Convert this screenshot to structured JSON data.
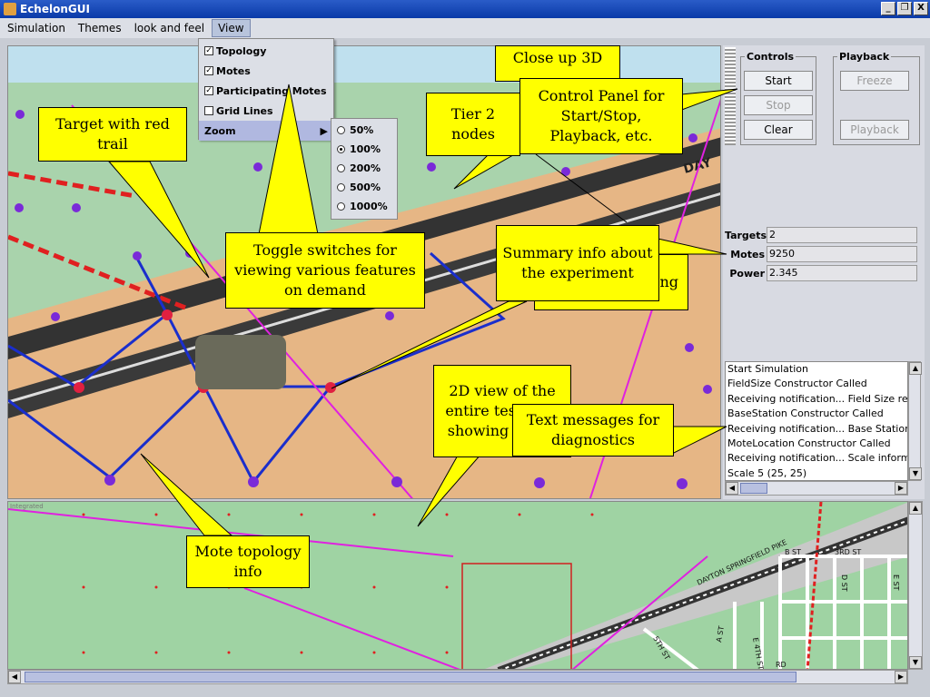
{
  "window": {
    "title": "EchelonGUI",
    "minimize": "_",
    "restore": "❐",
    "close": "X"
  },
  "menubar": [
    "Simulation",
    "Themes",
    "look and feel",
    "View"
  ],
  "view_menu": {
    "items": [
      {
        "label": "Topology",
        "checked": true
      },
      {
        "label": "Motes",
        "checked": true
      },
      {
        "label": "Participating Motes",
        "checked": true
      },
      {
        "label": "Grid Lines",
        "checked": false
      }
    ],
    "zoom_label": "Zoom",
    "zoom_options": [
      {
        "label": "50%",
        "selected": false
      },
      {
        "label": "100%",
        "selected": true
      },
      {
        "label": "200%",
        "selected": false
      },
      {
        "label": "500%",
        "selected": false
      },
      {
        "label": "1000%",
        "selected": false
      }
    ]
  },
  "controls": {
    "legend": "Controls",
    "start": "Start",
    "stop": "Stop",
    "clear": "Clear"
  },
  "playback": {
    "legend": "Playback",
    "freeze": "Freeze",
    "playback": "Playback"
  },
  "summary": {
    "targets_label": "Targets",
    "targets_value": "2",
    "motes_label": "Motes",
    "motes_value": "9250",
    "power_label": "Power",
    "power_value": "2.345"
  },
  "log": [
    "Start Simulation",
    "FieldSize Constructor Called",
    "Receiving notification... Field Size rea",
    "BaseStation Constructor Called",
    "Receiving notification... Base Station",
    "MoteLocation Constructor Called",
    "Receiving notification... Scale inform",
    "Scale 5 (25, 25)"
  ],
  "map_labels": {
    "road3d": "DAY",
    "dayton": "DAYTON SPRINGFIELD PIKE",
    "b_st": "B ST",
    "3rd_st": "3RD ST",
    "d_st": "D ST",
    "e_st": "E ST",
    "a_st": "A ST",
    "e_4th_st": "E 4TH ST",
    "5th_st": "5TH ST",
    "rd": "RD",
    "minimap_tag": "Integrated"
  },
  "callouts": {
    "close_up_3d": "Close up 3D",
    "tier2": "Tier 2 nodes",
    "control_panel": "Control Panel for Start/Stop, Playback, etc.",
    "target": "Target with red trail",
    "toggle": "Toggle switches for viewing various features on demand",
    "summary": "Summary info about the experiment",
    "summary_behind": "ng",
    "view2d": "2D view of the entire test area showing nodes",
    "text_messages": "Text messages for diagnostics",
    "mote_topology": "Mote topology info"
  },
  "colors": {
    "callout": "#ffff00",
    "terrain": "#e6b685",
    "grass": "#9fd3a3",
    "sky": "#bfe0ee",
    "link": "#1a2ecc",
    "magenta": "#e020e0",
    "trail": "#e02020",
    "mote": "#7a2ad8"
  }
}
